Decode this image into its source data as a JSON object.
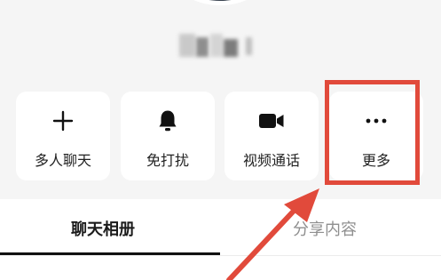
{
  "actions": [
    {
      "label": "多人聊天",
      "icon": "plus-icon"
    },
    {
      "label": "免打扰",
      "icon": "bell-icon"
    },
    {
      "label": "视频通话",
      "icon": "video-camera-icon"
    },
    {
      "label": "更多",
      "icon": "more-dots-icon"
    }
  ],
  "tabs": [
    {
      "label": "聊天相册",
      "active": true
    },
    {
      "label": "分享内容",
      "active": false
    }
  ],
  "annotation": {
    "highlight_color": "#e14a3b",
    "highlighted_action": "更多"
  }
}
